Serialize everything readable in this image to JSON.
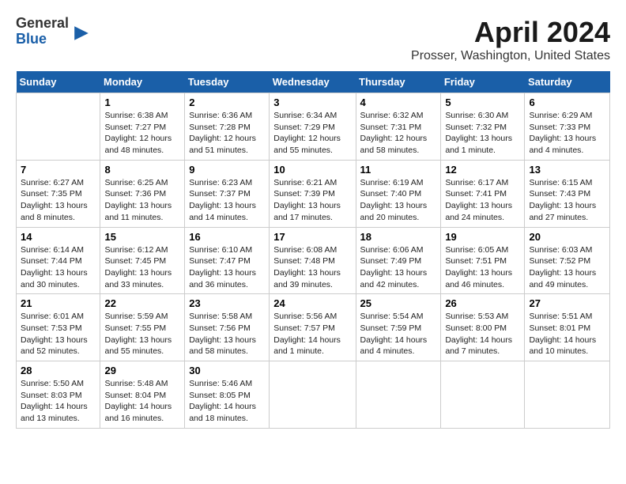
{
  "logo": {
    "general": "General",
    "blue": "Blue",
    "arrow": "▶"
  },
  "title": "April 2024",
  "location": "Prosser, Washington, United States",
  "weekdays": [
    "Sunday",
    "Monday",
    "Tuesday",
    "Wednesday",
    "Thursday",
    "Friday",
    "Saturday"
  ],
  "weeks": [
    [
      {
        "day": "",
        "sunrise": "",
        "sunset": "",
        "daylight": ""
      },
      {
        "day": "1",
        "sunrise": "Sunrise: 6:38 AM",
        "sunset": "Sunset: 7:27 PM",
        "daylight": "Daylight: 12 hours and 48 minutes."
      },
      {
        "day": "2",
        "sunrise": "Sunrise: 6:36 AM",
        "sunset": "Sunset: 7:28 PM",
        "daylight": "Daylight: 12 hours and 51 minutes."
      },
      {
        "day": "3",
        "sunrise": "Sunrise: 6:34 AM",
        "sunset": "Sunset: 7:29 PM",
        "daylight": "Daylight: 12 hours and 55 minutes."
      },
      {
        "day": "4",
        "sunrise": "Sunrise: 6:32 AM",
        "sunset": "Sunset: 7:31 PM",
        "daylight": "Daylight: 12 hours and 58 minutes."
      },
      {
        "day": "5",
        "sunrise": "Sunrise: 6:30 AM",
        "sunset": "Sunset: 7:32 PM",
        "daylight": "Daylight: 13 hours and 1 minute."
      },
      {
        "day": "6",
        "sunrise": "Sunrise: 6:29 AM",
        "sunset": "Sunset: 7:33 PM",
        "daylight": "Daylight: 13 hours and 4 minutes."
      }
    ],
    [
      {
        "day": "7",
        "sunrise": "Sunrise: 6:27 AM",
        "sunset": "Sunset: 7:35 PM",
        "daylight": "Daylight: 13 hours and 8 minutes."
      },
      {
        "day": "8",
        "sunrise": "Sunrise: 6:25 AM",
        "sunset": "Sunset: 7:36 PM",
        "daylight": "Daylight: 13 hours and 11 minutes."
      },
      {
        "day": "9",
        "sunrise": "Sunrise: 6:23 AM",
        "sunset": "Sunset: 7:37 PM",
        "daylight": "Daylight: 13 hours and 14 minutes."
      },
      {
        "day": "10",
        "sunrise": "Sunrise: 6:21 AM",
        "sunset": "Sunset: 7:39 PM",
        "daylight": "Daylight: 13 hours and 17 minutes."
      },
      {
        "day": "11",
        "sunrise": "Sunrise: 6:19 AM",
        "sunset": "Sunset: 7:40 PM",
        "daylight": "Daylight: 13 hours and 20 minutes."
      },
      {
        "day": "12",
        "sunrise": "Sunrise: 6:17 AM",
        "sunset": "Sunset: 7:41 PM",
        "daylight": "Daylight: 13 hours and 24 minutes."
      },
      {
        "day": "13",
        "sunrise": "Sunrise: 6:15 AM",
        "sunset": "Sunset: 7:43 PM",
        "daylight": "Daylight: 13 hours and 27 minutes."
      }
    ],
    [
      {
        "day": "14",
        "sunrise": "Sunrise: 6:14 AM",
        "sunset": "Sunset: 7:44 PM",
        "daylight": "Daylight: 13 hours and 30 minutes."
      },
      {
        "day": "15",
        "sunrise": "Sunrise: 6:12 AM",
        "sunset": "Sunset: 7:45 PM",
        "daylight": "Daylight: 13 hours and 33 minutes."
      },
      {
        "day": "16",
        "sunrise": "Sunrise: 6:10 AM",
        "sunset": "Sunset: 7:47 PM",
        "daylight": "Daylight: 13 hours and 36 minutes."
      },
      {
        "day": "17",
        "sunrise": "Sunrise: 6:08 AM",
        "sunset": "Sunset: 7:48 PM",
        "daylight": "Daylight: 13 hours and 39 minutes."
      },
      {
        "day": "18",
        "sunrise": "Sunrise: 6:06 AM",
        "sunset": "Sunset: 7:49 PM",
        "daylight": "Daylight: 13 hours and 42 minutes."
      },
      {
        "day": "19",
        "sunrise": "Sunrise: 6:05 AM",
        "sunset": "Sunset: 7:51 PM",
        "daylight": "Daylight: 13 hours and 46 minutes."
      },
      {
        "day": "20",
        "sunrise": "Sunrise: 6:03 AM",
        "sunset": "Sunset: 7:52 PM",
        "daylight": "Daylight: 13 hours and 49 minutes."
      }
    ],
    [
      {
        "day": "21",
        "sunrise": "Sunrise: 6:01 AM",
        "sunset": "Sunset: 7:53 PM",
        "daylight": "Daylight: 13 hours and 52 minutes."
      },
      {
        "day": "22",
        "sunrise": "Sunrise: 5:59 AM",
        "sunset": "Sunset: 7:55 PM",
        "daylight": "Daylight: 13 hours and 55 minutes."
      },
      {
        "day": "23",
        "sunrise": "Sunrise: 5:58 AM",
        "sunset": "Sunset: 7:56 PM",
        "daylight": "Daylight: 13 hours and 58 minutes."
      },
      {
        "day": "24",
        "sunrise": "Sunrise: 5:56 AM",
        "sunset": "Sunset: 7:57 PM",
        "daylight": "Daylight: 14 hours and 1 minute."
      },
      {
        "day": "25",
        "sunrise": "Sunrise: 5:54 AM",
        "sunset": "Sunset: 7:59 PM",
        "daylight": "Daylight: 14 hours and 4 minutes."
      },
      {
        "day": "26",
        "sunrise": "Sunrise: 5:53 AM",
        "sunset": "Sunset: 8:00 PM",
        "daylight": "Daylight: 14 hours and 7 minutes."
      },
      {
        "day": "27",
        "sunrise": "Sunrise: 5:51 AM",
        "sunset": "Sunset: 8:01 PM",
        "daylight": "Daylight: 14 hours and 10 minutes."
      }
    ],
    [
      {
        "day": "28",
        "sunrise": "Sunrise: 5:50 AM",
        "sunset": "Sunset: 8:03 PM",
        "daylight": "Daylight: 14 hours and 13 minutes."
      },
      {
        "day": "29",
        "sunrise": "Sunrise: 5:48 AM",
        "sunset": "Sunset: 8:04 PM",
        "daylight": "Daylight: 14 hours and 16 minutes."
      },
      {
        "day": "30",
        "sunrise": "Sunrise: 5:46 AM",
        "sunset": "Sunset: 8:05 PM",
        "daylight": "Daylight: 14 hours and 18 minutes."
      },
      {
        "day": "",
        "sunrise": "",
        "sunset": "",
        "daylight": ""
      },
      {
        "day": "",
        "sunrise": "",
        "sunset": "",
        "daylight": ""
      },
      {
        "day": "",
        "sunrise": "",
        "sunset": "",
        "daylight": ""
      },
      {
        "day": "",
        "sunrise": "",
        "sunset": "",
        "daylight": ""
      }
    ]
  ]
}
